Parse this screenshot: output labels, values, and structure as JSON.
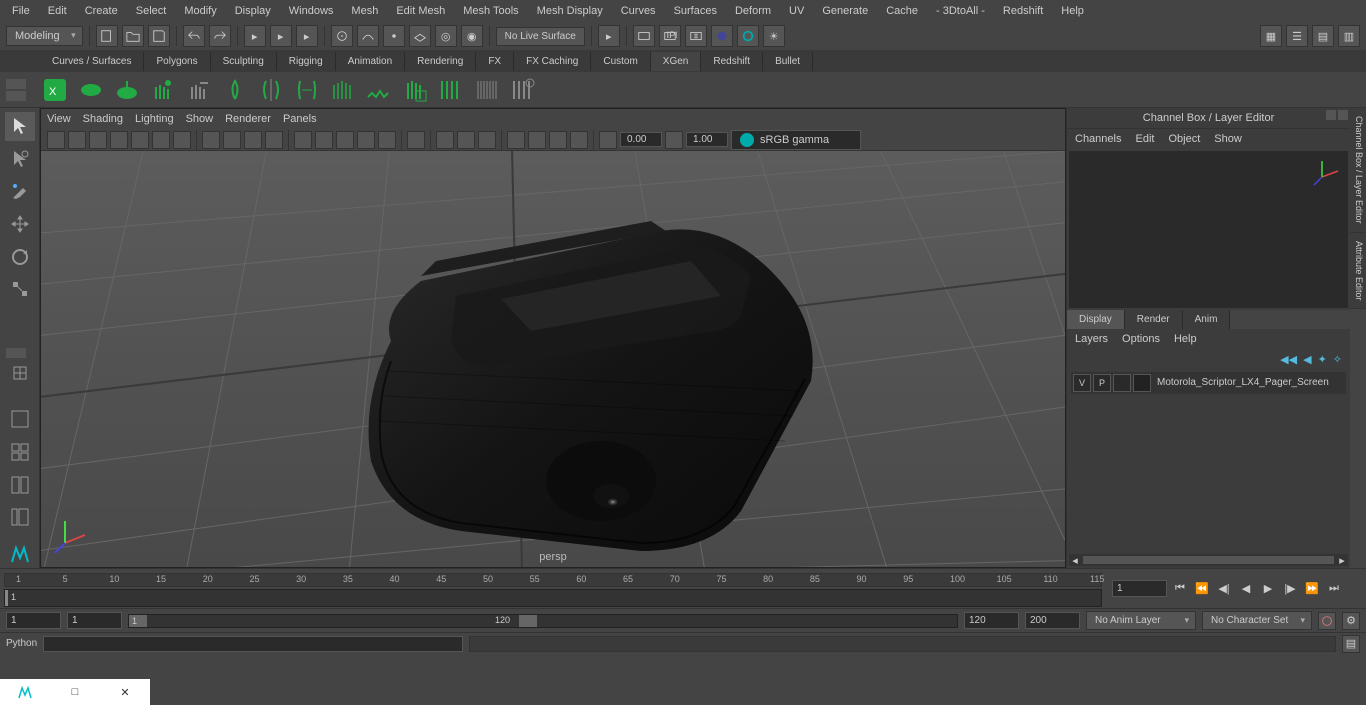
{
  "menubar": [
    "File",
    "Edit",
    "Create",
    "Select",
    "Modify",
    "Display",
    "Windows",
    "Mesh",
    "Edit Mesh",
    "Mesh Tools",
    "Mesh Display",
    "Curves",
    "Surfaces",
    "Deform",
    "UV",
    "Generate",
    "Cache",
    "- 3DtoAll -",
    "Redshift",
    "Help"
  ],
  "workspace": "Modeling",
  "nolive": "No Live Surface",
  "shelf_tabs": [
    "Curves / Surfaces",
    "Polygons",
    "Sculpting",
    "Rigging",
    "Animation",
    "Rendering",
    "FX",
    "FX Caching",
    "Custom",
    "XGen",
    "Redshift",
    "Bullet"
  ],
  "shelf_active": "XGen",
  "panel_menu": [
    "View",
    "Shading",
    "Lighting",
    "Show",
    "Renderer",
    "Panels"
  ],
  "gamma": "1.00",
  "exposure": "0.00",
  "colorspace": "sRGB gamma",
  "camera": "persp",
  "channelbox": {
    "title": "Channel Box / Layer Editor",
    "menu": [
      "Channels",
      "Edit",
      "Object",
      "Show"
    ]
  },
  "layer_tabs": [
    "Display",
    "Render",
    "Anim"
  ],
  "layer_active": "Display",
  "layer_menu": [
    "Layers",
    "Options",
    "Help"
  ],
  "layer_row": {
    "v": "V",
    "p": "P",
    "name": "Motorola_Scriptor_LX4_Pager_Screen"
  },
  "side_tabs": [
    "Channel Box / Layer Editor",
    "Attribute Editor"
  ],
  "time": {
    "ticks": [
      "1",
      "5",
      "10",
      "15",
      "20",
      "25",
      "30",
      "35",
      "40",
      "45",
      "50",
      "55",
      "60",
      "65",
      "70",
      "75",
      "80",
      "85",
      "90",
      "95",
      "100",
      "105",
      "110",
      "115"
    ],
    "current": "1",
    "start": "1",
    "end": "120",
    "range_start": "1",
    "range_end": "120",
    "max": "200"
  },
  "anim_layer": "No Anim Layer",
  "char_set": "No Character Set",
  "cmd_lang": "Python"
}
